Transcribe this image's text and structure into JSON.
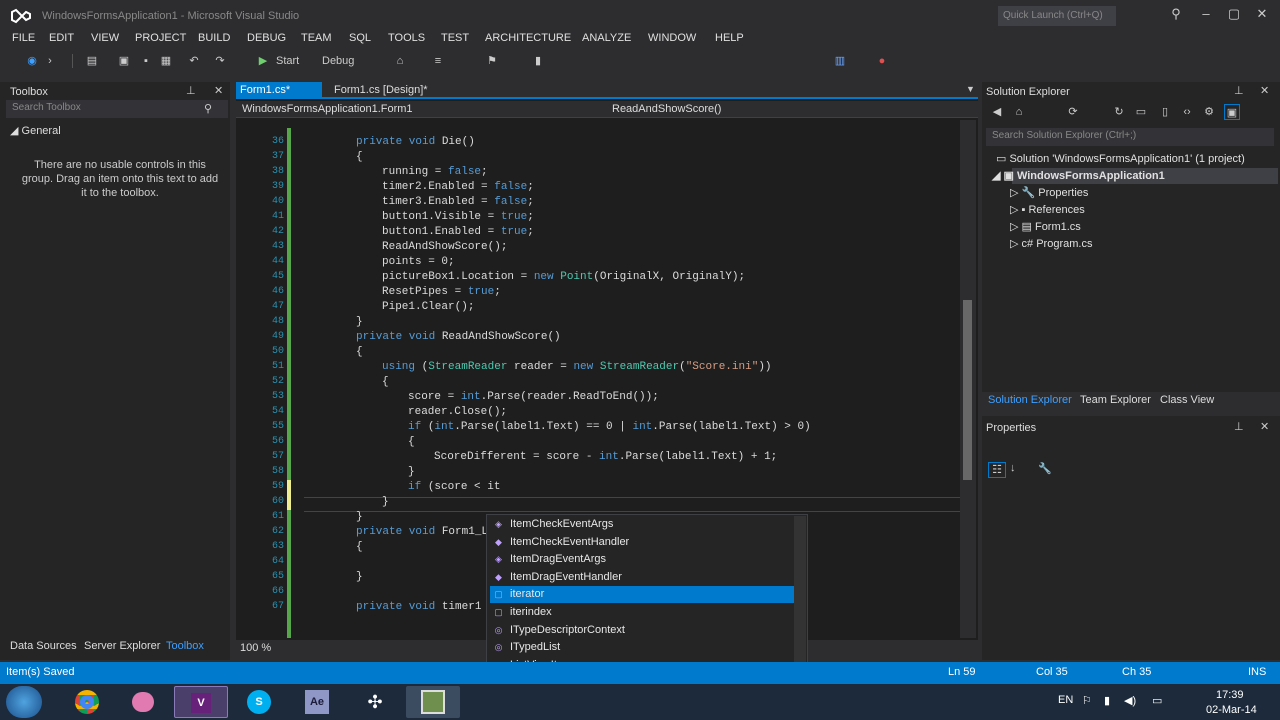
{
  "window": {
    "title": "WindowsFormsApplication1 - Microsoft Visual Studio",
    "quick_launch": "Quick Launch (Ctrl+Q)"
  },
  "menu": [
    "FILE",
    "EDIT",
    "VIEW",
    "PROJECT",
    "BUILD",
    "DEBUG",
    "TEAM",
    "SQL",
    "TOOLS",
    "TEST",
    "ARCHITECTURE",
    "ANALYZE",
    "WINDOW",
    "HELP"
  ],
  "toolbar": {
    "start": "Start",
    "config": "Debug"
  },
  "toolbox": {
    "title": "Toolbox",
    "search": "Search Toolbox",
    "group": "General",
    "message": "There are no usable controls in this group. Drag an item onto this text to add it to the toolbox.",
    "tabs": [
      "Data Sources",
      "Server Explorer",
      "Toolbox"
    ]
  },
  "editor": {
    "tab_active": "Form1.cs*",
    "tab_design": "Form1.cs [Design]*",
    "nav_left": "WindowsFormsApplication1.Form1",
    "nav_right": "ReadAndShowScore()",
    "zoom": "100 %"
  },
  "code": {
    "line_numbers": [
      "36",
      "37",
      "38",
      "39",
      "40",
      "41",
      "42",
      "43",
      "44",
      "45",
      "46",
      "47",
      "48",
      "49",
      "50",
      "51",
      "52",
      "53",
      "54",
      "55",
      "56",
      "57",
      "58",
      "59",
      "60",
      "61",
      "62",
      "63",
      "64",
      "65",
      "66",
      "67"
    ],
    "lines": [
      [
        [
          "kw",
          "private void "
        ],
        [
          "",
          "Die()"
        ]
      ],
      [
        [
          "",
          "{"
        ]
      ],
      [
        [
          "",
          "running = "
        ],
        [
          "kw",
          "false"
        ],
        [
          "",
          ";"
        ]
      ],
      [
        [
          "",
          "timer2.Enabled = "
        ],
        [
          "kw",
          "false"
        ],
        [
          "",
          ";"
        ]
      ],
      [
        [
          "",
          "timer3.Enabled = "
        ],
        [
          "kw",
          "false"
        ],
        [
          "",
          ";"
        ]
      ],
      [
        [
          "",
          "button1.Visible = "
        ],
        [
          "kw",
          "true"
        ],
        [
          "",
          ";"
        ]
      ],
      [
        [
          "",
          "button1.Enabled = "
        ],
        [
          "kw",
          "true"
        ],
        [
          "",
          ";"
        ]
      ],
      [
        [
          "",
          "ReadAndShowScore();"
        ]
      ],
      [
        [
          "",
          "points = 0;"
        ]
      ],
      [
        [
          "",
          "pictureBox1.Location = "
        ],
        [
          "kw",
          "new "
        ],
        [
          "ty",
          "Point"
        ],
        [
          "",
          "(OriginalX, OriginalY);"
        ]
      ],
      [
        [
          "",
          "ResetPipes = "
        ],
        [
          "kw",
          "true"
        ],
        [
          "",
          ";"
        ]
      ],
      [
        [
          "",
          "Pipe1.Clear();"
        ]
      ],
      [
        [
          "",
          "}"
        ]
      ],
      [
        [
          "kw",
          "private void "
        ],
        [
          "",
          "ReadAndShowScore()"
        ]
      ],
      [
        [
          "",
          "{"
        ]
      ],
      [
        [
          "kw",
          "using "
        ],
        [
          "",
          "("
        ],
        [
          "ty",
          "StreamReader"
        ],
        [
          "",
          " reader = "
        ],
        [
          "kw",
          "new "
        ],
        [
          "ty",
          "StreamReader"
        ],
        [
          "",
          "("
        ],
        [
          "st",
          "\"Score.ini\""
        ],
        [
          "",
          "))"
        ]
      ],
      [
        [
          "",
          "{"
        ]
      ],
      [
        [
          "",
          "score = "
        ],
        [
          "kw",
          "int"
        ],
        [
          "",
          ".Parse(reader.ReadToEnd());"
        ]
      ],
      [
        [
          "",
          "reader.Close();"
        ]
      ],
      [
        [
          "kw",
          "if "
        ],
        [
          "",
          "("
        ],
        [
          "kw",
          "int"
        ],
        [
          "",
          ".Parse(label1.Text) == 0 | "
        ],
        [
          "kw",
          "int"
        ],
        [
          "",
          ".Parse(label1.Text) > 0)"
        ]
      ],
      [
        [
          "",
          "{"
        ]
      ],
      [
        [
          "",
          "ScoreDifferent = score - "
        ],
        [
          "kw",
          "int"
        ],
        [
          "",
          ".Parse(label1.Text) + 1;"
        ]
      ],
      [
        [
          "",
          "}"
        ]
      ],
      [
        [
          "kw",
          "if "
        ],
        [
          "",
          "(score < it"
        ]
      ],
      [
        [
          "",
          "}"
        ]
      ],
      [
        [
          "",
          "}"
        ]
      ],
      [
        [
          "kw",
          "private void "
        ],
        [
          "",
          "Form1_L"
        ]
      ],
      [
        [
          "",
          "{"
        ]
      ],
      [
        [
          "",
          ""
        ]
      ],
      [
        [
          "",
          "}"
        ]
      ],
      [
        [
          "",
          ""
        ]
      ],
      [
        [
          "kw",
          "private void "
        ],
        [
          "",
          "timer1"
        ]
      ]
    ]
  },
  "intellisense": [
    {
      "label": "ItemCheckEventArgs",
      "icon": "class-icon"
    },
    {
      "label": "ItemCheckEventHandler",
      "icon": "delegate-icon"
    },
    {
      "label": "ItemDragEventArgs",
      "icon": "class-icon"
    },
    {
      "label": "ItemDragEventHandler",
      "icon": "delegate-icon"
    },
    {
      "label": "iterator",
      "icon": "snippet-icon",
      "selected": true
    },
    {
      "label": "iterindex",
      "icon": "snippet-icon"
    },
    {
      "label": "ITypeDescriptorContext",
      "icon": "interface-icon"
    },
    {
      "label": "ITypedList",
      "icon": "interface-icon"
    },
    {
      "label": "ListViewItem",
      "icon": "class-icon"
    }
  ],
  "solution_explorer": {
    "title": "Solution Explorer",
    "search": "Search Solution Explorer (Ctrl+;)",
    "solution": "Solution 'WindowsFormsApplication1' (1 project)",
    "project": "WindowsFormsApplication1",
    "items": [
      "Properties",
      "References",
      "Form1.cs",
      "Program.cs"
    ],
    "tabs": [
      "Solution Explorer",
      "Team Explorer",
      "Class View"
    ]
  },
  "properties": {
    "title": "Properties"
  },
  "status": {
    "message": "Item(s) Saved",
    "ln": "Ln 59",
    "col": "Col 35",
    "ch": "Ch 35",
    "mode": "INS"
  },
  "tray": {
    "lang": "EN",
    "time": "17:39",
    "date": "02-Mar-14"
  },
  "colors": {
    "accent": "#007acc",
    "background": "#2d2d30",
    "editor": "#1e1e1e",
    "taskbar": "#1c2a3b"
  }
}
